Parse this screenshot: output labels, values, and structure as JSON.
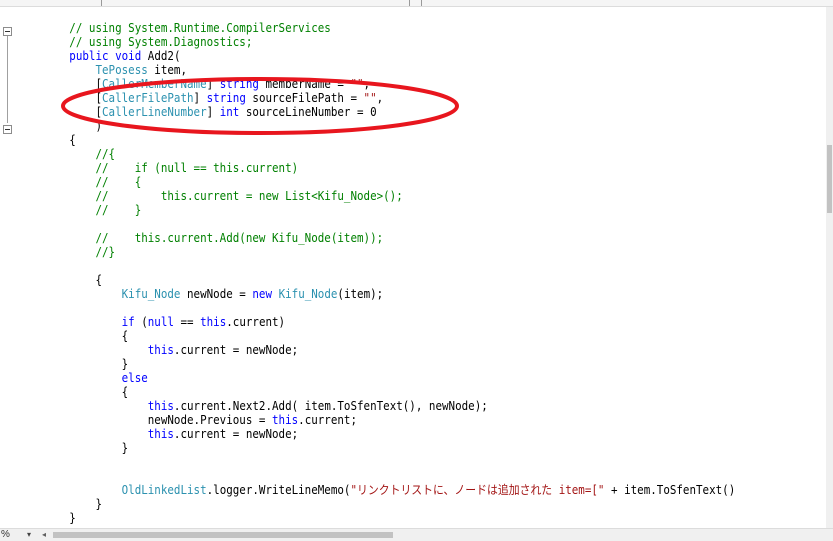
{
  "editor": {
    "zoom": "%",
    "colors": {
      "keyword": "#0000ff",
      "comment": "#008000",
      "type": "#2b91af",
      "string": "#a31515",
      "highlight_ellipse": "#e8161e"
    },
    "lines": [
      [
        [
          "cm",
          "        // using System.Runtime.CompilerServices"
        ]
      ],
      [
        [
          "cm",
          "        // using System.Diagnostics;"
        ]
      ],
      [
        [
          "tx",
          "        "
        ],
        [
          "kw",
          "public"
        ],
        [
          "tx",
          " "
        ],
        [
          "kw",
          "void"
        ],
        [
          "tx",
          " Add2("
        ]
      ],
      [
        [
          "tx",
          "            "
        ],
        [
          "ty",
          "TePosess"
        ],
        [
          "tx",
          " item,"
        ]
      ],
      [
        [
          "tx",
          "            ["
        ],
        [
          "ty",
          "CallerMemberName"
        ],
        [
          "tx",
          "] "
        ],
        [
          "kw",
          "string"
        ],
        [
          "tx",
          " memberName = "
        ],
        [
          "st",
          "\"\""
        ],
        [
          "tx",
          ","
        ]
      ],
      [
        [
          "tx",
          "            ["
        ],
        [
          "ty",
          "CallerFilePath"
        ],
        [
          "tx",
          "] "
        ],
        [
          "kw",
          "string"
        ],
        [
          "tx",
          " sourceFilePath = "
        ],
        [
          "st",
          "\"\""
        ],
        [
          "tx",
          ","
        ]
      ],
      [
        [
          "tx",
          "            ["
        ],
        [
          "ty",
          "CallerLineNumber"
        ],
        [
          "tx",
          "] "
        ],
        [
          "kw",
          "int"
        ],
        [
          "tx",
          " sourceLineNumber = 0"
        ]
      ],
      [
        [
          "tx",
          "            )"
        ]
      ],
      [
        [
          "tx",
          "        {"
        ]
      ],
      [
        [
          "cm",
          "            //{"
        ]
      ],
      [
        [
          "cm",
          "            //    if (null == this.current)"
        ]
      ],
      [
        [
          "cm",
          "            //    {"
        ]
      ],
      [
        [
          "cm",
          "            //        this.current = new List<Kifu_Node>();"
        ]
      ],
      [
        [
          "cm",
          "            //    }"
        ]
      ],
      [
        [
          "tx",
          ""
        ]
      ],
      [
        [
          "cm",
          "            //    this.current.Add(new Kifu_Node(item));"
        ]
      ],
      [
        [
          "cm",
          "            //}"
        ]
      ],
      [
        [
          "tx",
          ""
        ]
      ],
      [
        [
          "tx",
          "            {"
        ]
      ],
      [
        [
          "tx",
          "                "
        ],
        [
          "ty",
          "Kifu_Node"
        ],
        [
          "tx",
          " newNode = "
        ],
        [
          "kw",
          "new"
        ],
        [
          "tx",
          " "
        ],
        [
          "ty",
          "Kifu_Node"
        ],
        [
          "tx",
          "(item);"
        ]
      ],
      [
        [
          "tx",
          ""
        ]
      ],
      [
        [
          "tx",
          "                "
        ],
        [
          "kw",
          "if"
        ],
        [
          "tx",
          " ("
        ],
        [
          "kw",
          "null"
        ],
        [
          "tx",
          " == "
        ],
        [
          "kw",
          "this"
        ],
        [
          "tx",
          ".current)"
        ]
      ],
      [
        [
          "tx",
          "                {"
        ]
      ],
      [
        [
          "tx",
          "                    "
        ],
        [
          "kw",
          "this"
        ],
        [
          "tx",
          ".current = newNode;"
        ]
      ],
      [
        [
          "tx",
          "                }"
        ]
      ],
      [
        [
          "tx",
          "                "
        ],
        [
          "kw",
          "else"
        ]
      ],
      [
        [
          "tx",
          "                {"
        ]
      ],
      [
        [
          "tx",
          "                    "
        ],
        [
          "kw",
          "this"
        ],
        [
          "tx",
          ".current.Next2.Add( item.ToSfenText(), newNode);"
        ]
      ],
      [
        [
          "tx",
          "                    newNode.Previous = "
        ],
        [
          "kw",
          "this"
        ],
        [
          "tx",
          ".current;"
        ]
      ],
      [
        [
          "tx",
          "                    "
        ],
        [
          "kw",
          "this"
        ],
        [
          "tx",
          ".current = newNode;"
        ]
      ],
      [
        [
          "tx",
          "                }"
        ]
      ],
      [
        [
          "tx",
          ""
        ]
      ],
      [
        [
          "tx",
          ""
        ]
      ],
      [
        [
          "tx",
          "                "
        ],
        [
          "ty",
          "OldLinkedList"
        ],
        [
          "tx",
          ".logger.WriteLineMemo("
        ],
        [
          "st",
          "\"リンクトリストに、ノードは追加された item=[\""
        ],
        [
          "tx",
          " + item.ToSfenText()"
        ]
      ],
      [
        [
          "tx",
          "            }"
        ]
      ],
      [
        [
          "tx",
          "        }"
        ]
      ]
    ]
  }
}
